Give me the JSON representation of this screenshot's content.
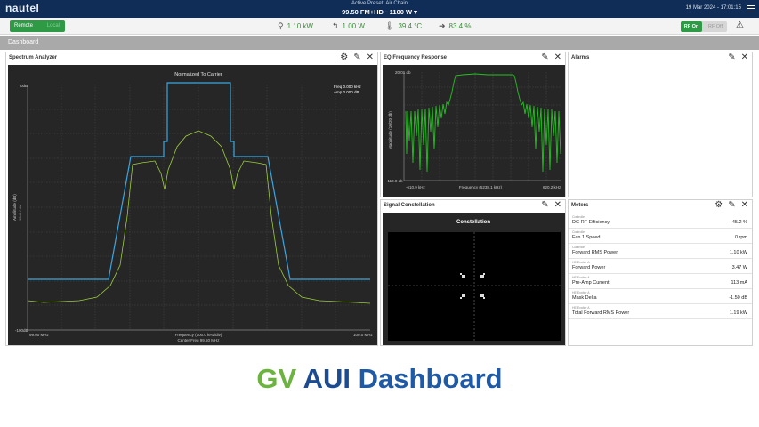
{
  "header": {
    "logo": "nautel",
    "preset_label": "Active Preset: Air Chain",
    "frequency_line": "99.50 FM+HD · 1100 W ▾",
    "datetime": "19 Mar 2024 - 17:01:15"
  },
  "status": {
    "remote_label": "Remote",
    "local_label": "Local",
    "metrics": [
      {
        "icon": "tower-icon",
        "value": "1.10 kW"
      },
      {
        "icon": "reflected-power-icon",
        "value": "1.00 W"
      },
      {
        "icon": "thermometer-icon",
        "value": "39.4 °C"
      },
      {
        "icon": "efficiency-icon",
        "value": "83.4 %"
      }
    ],
    "rf_on_label": "RF On",
    "rf_off_label": "RF Off"
  },
  "dashboard_tab": "Dashboard",
  "spectrum": {
    "title": "Spectrum Analyzer",
    "plot_title": "Normalized To Carrier",
    "y_top": "0dB",
    "y_bottom": "-100dB",
    "y_axis_label": "Amplitude (dB)",
    "y_axis_sub": "10dB / div",
    "x_left": "99.00 MHz",
    "x_right": "100.0 MHz",
    "x_label": "Frequency (100.0 kHz/div)",
    "center": "Center Freq 99.50 MHz",
    "readout_freq": "Freq 0.000 kHz",
    "readout_amp": "Amp 0.000 dB"
  },
  "eq": {
    "title": "EQ Frequency Response",
    "y_top": "20.01 db",
    "y_bottom": "-110.0 db",
    "y_axis_label": "Magnitude (10/20 db)",
    "x_left": "-610.9 kHz",
    "x_label": "Frequency (5238.1 kHz)",
    "x_right": "620.2 kHz"
  },
  "alarms": {
    "title": "Alarms"
  },
  "constellation": {
    "title": "Signal Constellation",
    "plot_title": "Constellation"
  },
  "meters": {
    "title": "Meters",
    "rows": [
      {
        "group": "Controller",
        "name": "DC-RF Efficiency",
        "value": "45.2 %"
      },
      {
        "group": "Controller",
        "name": "Fan 1 Speed",
        "value": "0 rpm"
      },
      {
        "group": "Controller",
        "name": "Forward RMS Power",
        "value": "1.10 kW"
      },
      {
        "group": "HE Exciter A",
        "name": "Forward Power",
        "value": "3.47 W"
      },
      {
        "group": "HE Exciter A",
        "name": "Pre-Amp Current",
        "value": "113 mA"
      },
      {
        "group": "HE Exciter A",
        "name": "Mask Delta",
        "value": "-1.50 dB"
      },
      {
        "group": "HE Exciter A",
        "name": "Total Forward RMS Power",
        "value": "1.19 kW"
      }
    ]
  },
  "caption": {
    "part1": "GV",
    "part2": "AUI",
    "part3": "Dashboard"
  },
  "colors": {
    "nav": "#0f2d56",
    "accent_green": "#2f9a46",
    "trace_green": "#9ccf3a",
    "mask_blue": "#3aa6e0",
    "eq_green": "#23c21e"
  }
}
